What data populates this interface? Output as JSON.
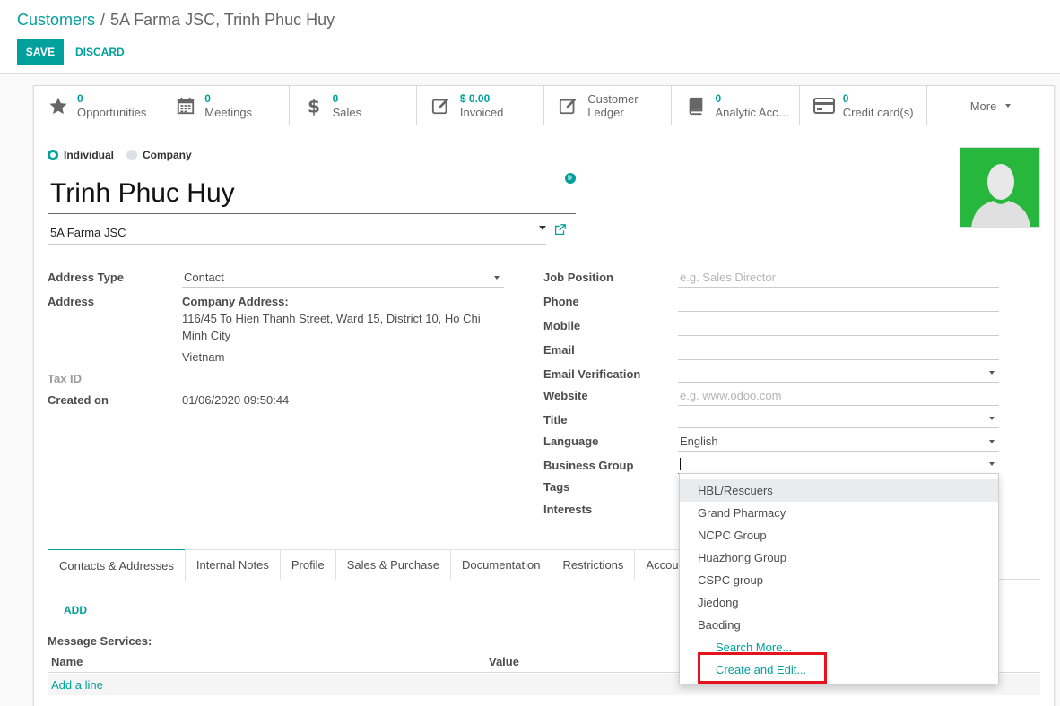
{
  "breadcrumb": {
    "parent": "Customers",
    "separator": "/",
    "current": "5A Farma JSC, Trinh Phuc Huy"
  },
  "actions": {
    "save": "SAVE",
    "discard": "DISCARD"
  },
  "stat_buttons": [
    {
      "icon": "star-icon",
      "value": "0",
      "label": "Opportunities"
    },
    {
      "icon": "calendar-icon",
      "value": "0",
      "label": "Meetings"
    },
    {
      "icon": "dollar-icon",
      "value": "0",
      "label": "Sales"
    },
    {
      "icon": "edit-icon",
      "value": "$ 0.00",
      "label": "Invoiced"
    },
    {
      "icon": "edit-icon",
      "value": "Customer",
      "label": "Ledger"
    },
    {
      "icon": "book-icon",
      "value": "0",
      "label": "Analytic Acc…"
    },
    {
      "icon": "credit-card-icon",
      "value": "0",
      "label": "Credit card(s)"
    }
  ],
  "more_label": "More",
  "company_type": {
    "individual": "Individual",
    "company": "Company",
    "selected": "Individual"
  },
  "partner": {
    "name": "Trinh Phuc Huy",
    "parent": "5A Farma JSC"
  },
  "left_fields": {
    "address_type_label": "Address Type",
    "address_type_value": "Contact",
    "address_label": "Address",
    "company_address_title": "Company Address:",
    "address_line1": "116/45 To Hien Thanh Street, Ward 15, District 10, Ho Chi",
    "address_line2": "Minh City",
    "country": "Vietnam",
    "tax_id_label": "Tax ID",
    "created_on_label": "Created on",
    "created_on_value": "01/06/2020 09:50:44"
  },
  "right_fields": {
    "job_position_label": "Job Position",
    "job_position_placeholder": "e.g. Sales Director",
    "phone_label": "Phone",
    "mobile_label": "Mobile",
    "email_label": "Email",
    "email_verification_label": "Email Verification",
    "website_label": "Website",
    "website_placeholder": "e.g. www.odoo.com",
    "title_label": "Title",
    "language_label": "Language",
    "language_value": "English",
    "business_group_label": "Business Group",
    "tags_label": "Tags",
    "interests_label": "Interests"
  },
  "tabs": [
    "Contacts & Addresses",
    "Internal Notes",
    "Profile",
    "Sales & Purchase",
    "Documentation",
    "Restrictions",
    "Accou"
  ],
  "contacts_tab": {
    "add": "ADD",
    "message_services": "Message Services:",
    "col_name": "Name",
    "col_value": "Value",
    "add_line": "Add a line"
  },
  "business_group_dropdown": {
    "options": [
      "HBL/Rescuers",
      "Grand Pharmacy",
      "NCPC Group",
      "Huazhong Group",
      "CSPC group",
      "Jiedong",
      "Baoding"
    ],
    "search_more": "Search More...",
    "create_and_edit": "Create and Edit..."
  },
  "colors": {
    "accent": "#00a09d",
    "avatar_bg": "#27b73c",
    "highlight_box": "#e3141b"
  }
}
